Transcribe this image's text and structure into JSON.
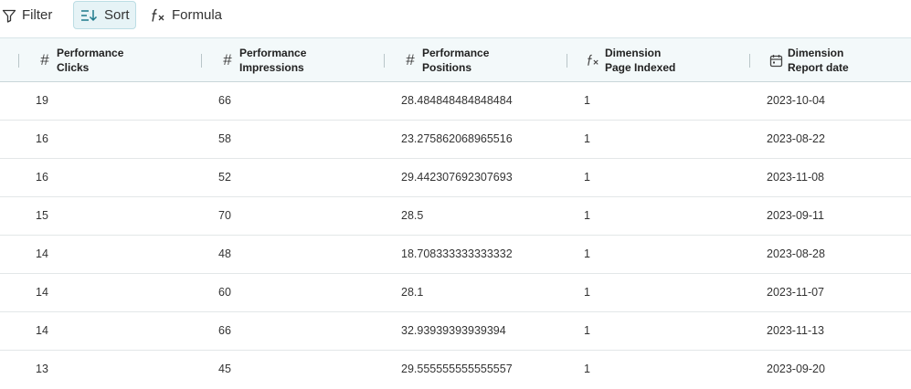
{
  "toolbar": {
    "filter_label": "Filter",
    "sort_label": "Sort",
    "formula_label": "Formula"
  },
  "columns": [
    {
      "line1": "Performance",
      "line2": "Clicks",
      "icon": "hash-icon"
    },
    {
      "line1": "Performance",
      "line2": "Impressions",
      "icon": "hash-icon"
    },
    {
      "line1": "Performance",
      "line2": "Positions",
      "icon": "hash-icon"
    },
    {
      "line1": "Dimension",
      "line2": "Page Indexed",
      "icon": "formula-icon"
    },
    {
      "line1": "Dimension",
      "line2": "Report date",
      "icon": "calendar-icon"
    }
  ],
  "rows": [
    [
      "19",
      "66",
      "28.484848484848484",
      "1",
      "2023-10-04"
    ],
    [
      "16",
      "58",
      "23.275862068965516",
      "1",
      "2023-08-22"
    ],
    [
      "16",
      "52",
      "29.442307692307693",
      "1",
      "2023-11-08"
    ],
    [
      "15",
      "70",
      "28.5",
      "1",
      "2023-09-11"
    ],
    [
      "14",
      "48",
      "18.708333333333332",
      "1",
      "2023-08-28"
    ],
    [
      "14",
      "60",
      "28.1",
      "1",
      "2023-11-07"
    ],
    [
      "14",
      "66",
      "32.93939393939394",
      "1",
      "2023-11-13"
    ],
    [
      "13",
      "45",
      "29.555555555555557",
      "1",
      "2023-09-20"
    ]
  ]
}
